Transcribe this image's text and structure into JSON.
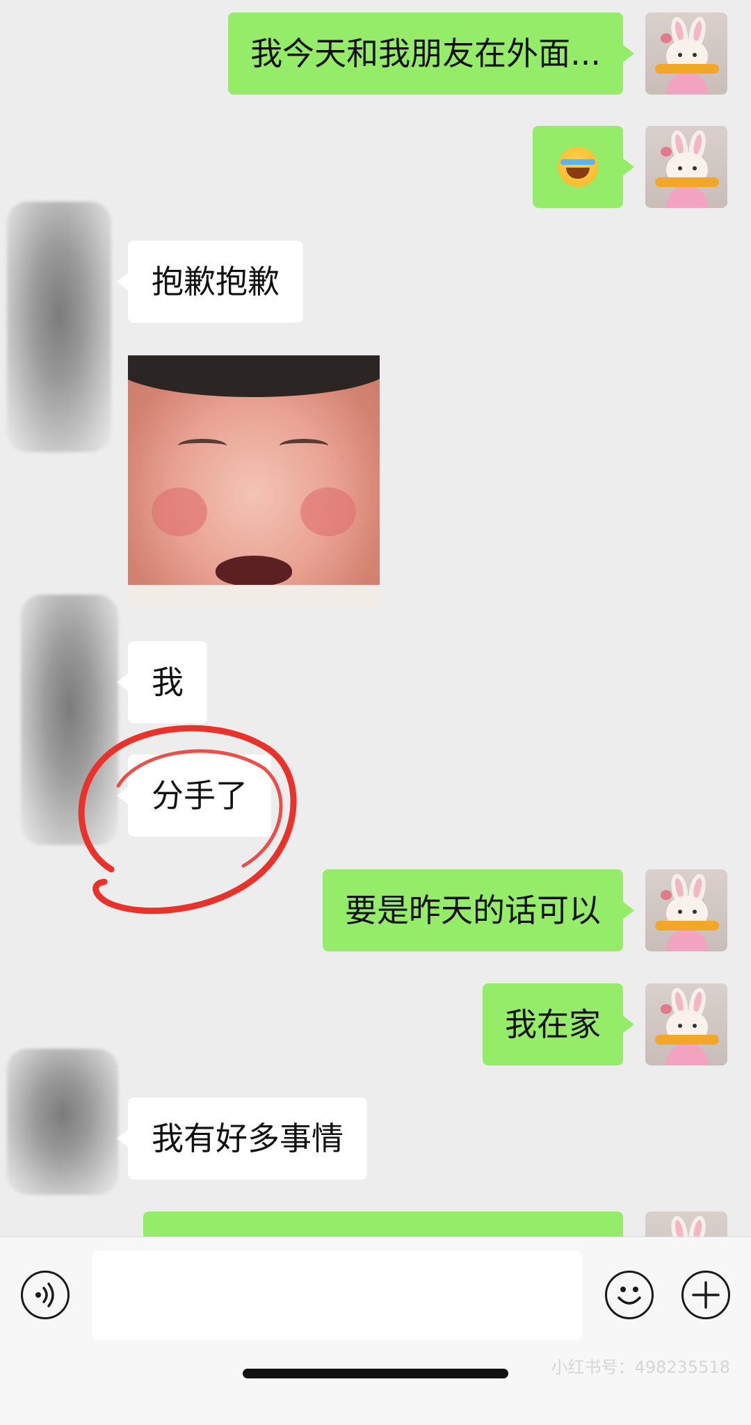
{
  "messages": {
    "m1": "我今天和我朋友在外面...",
    "m3": "抱歉抱歉",
    "m5": "我",
    "m6": "分手了",
    "m7": "要是昨天的话可以",
    "m8": "我在家",
    "m9": "我有好多事情",
    "m2_emoji": "loudly-crying-face-emoji",
    "m4_sticker": "crying-child-sticker"
  },
  "input": {
    "placeholder": ""
  },
  "watermark": "小红书号：498235518",
  "colors": {
    "sent_bubble": "#95ec69",
    "received_bubble": "#ffffff",
    "background": "#ededed",
    "annotation_circle": "#e8322a"
  }
}
